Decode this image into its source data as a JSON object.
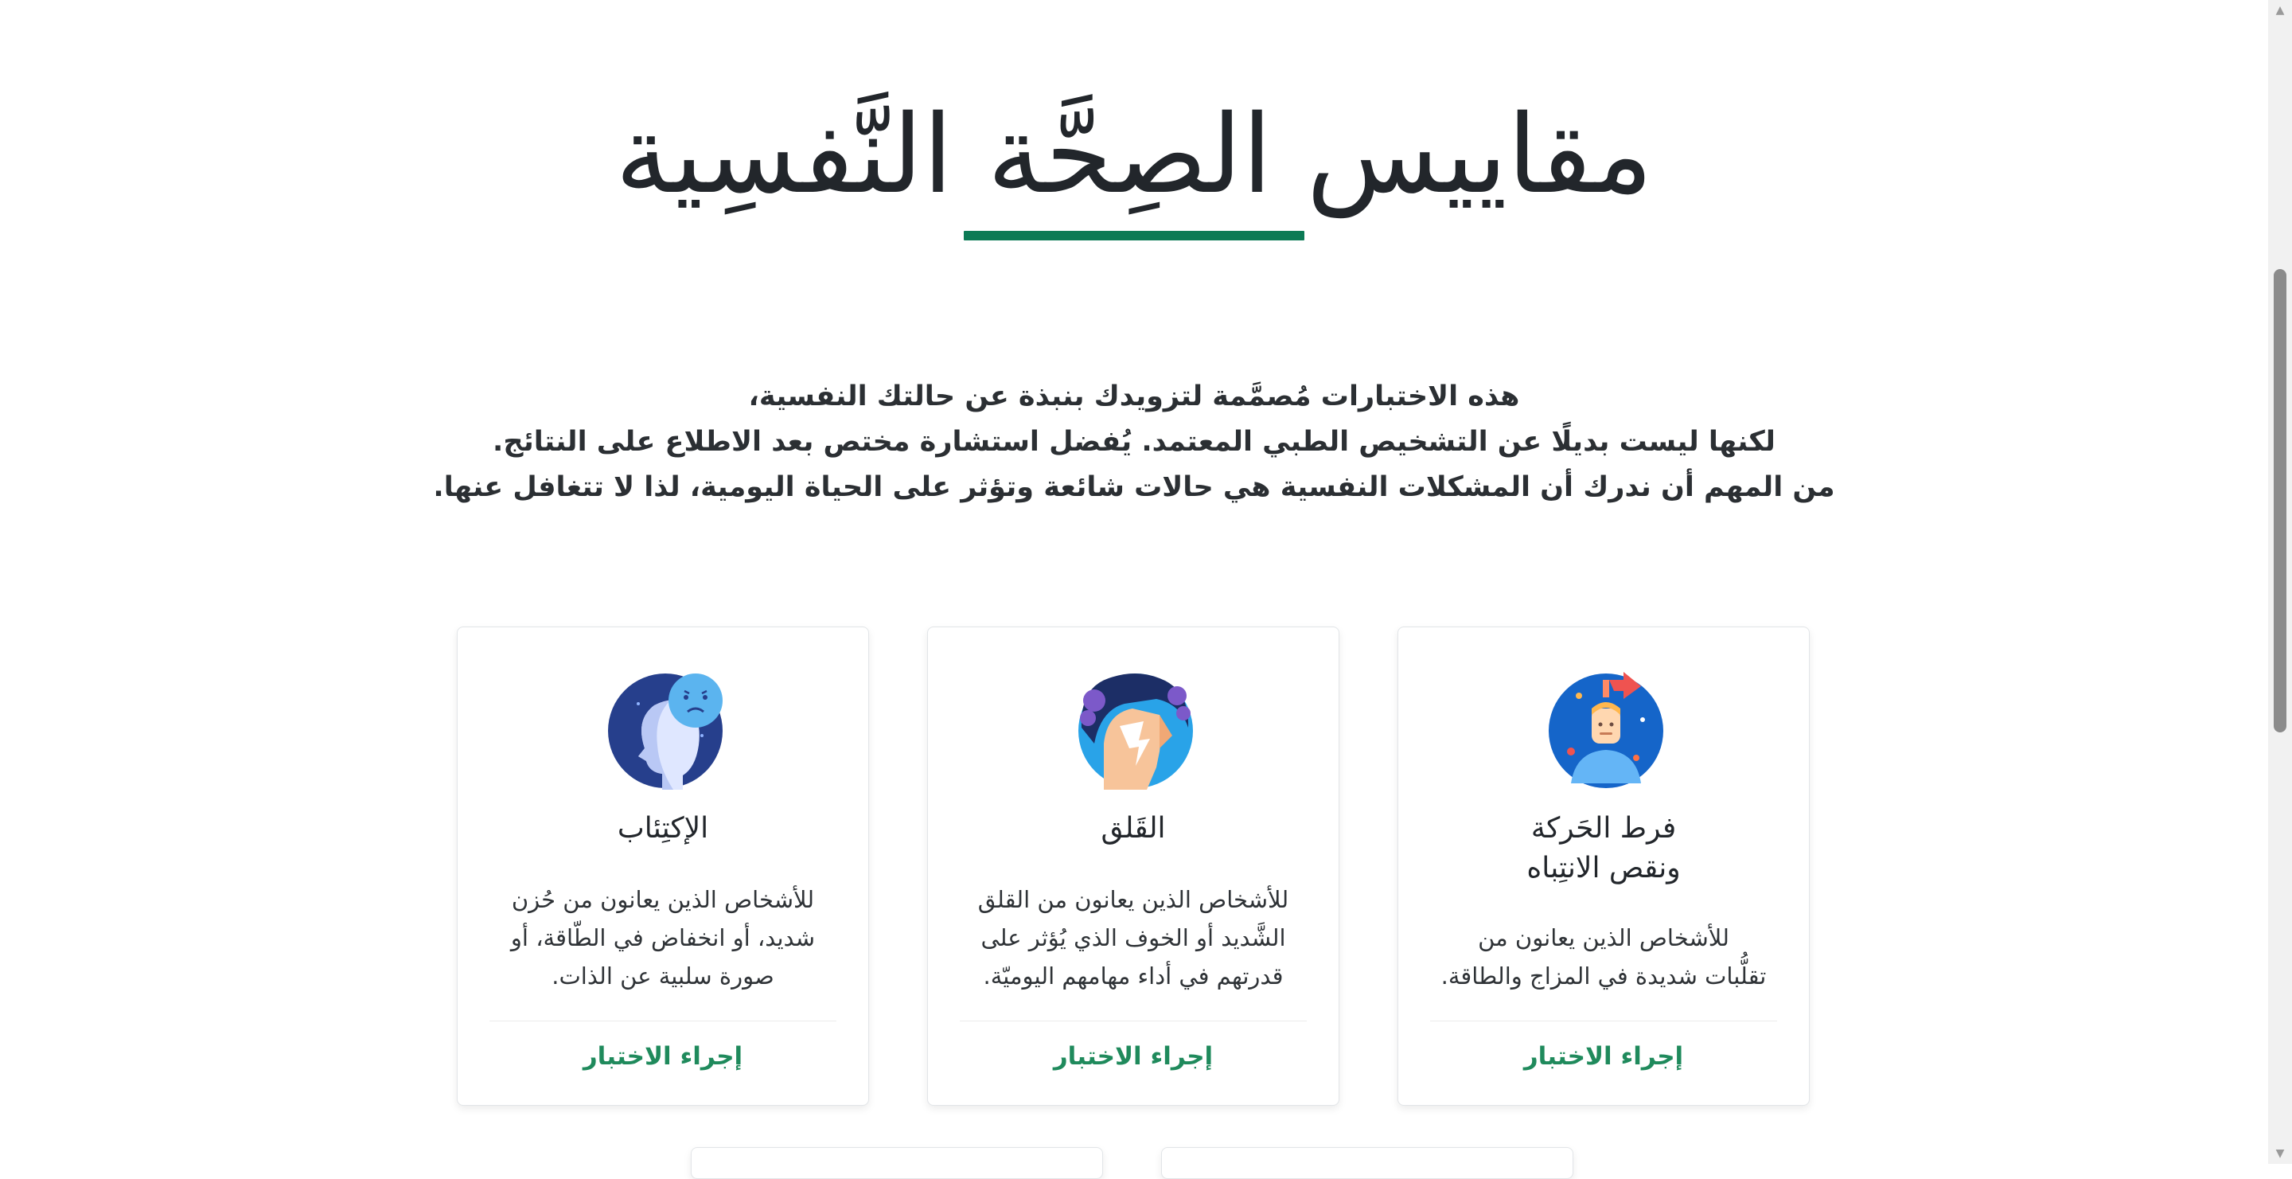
{
  "page": {
    "title": "مقاييس الصِحَّة النَّفسِية",
    "intro_lines": [
      "هذه الاختبارات مُصمَّمة لتزويدك بنبذة عن حالتك النفسية،",
      "لكنها ليست بديلًا عن التشخيص الطبي المعتمد. يُفضل استشارة مختص بعد الاطلاع على النتائج.",
      "من المهم أن ندرك أن المشكلات النفسية هي حالات شائعة وتؤثر على الحياة اليومية، لذا لا تتغافل عنها."
    ],
    "accent_color": "#0c7a55",
    "link_color": "#1f8a5c"
  },
  "cards": [
    {
      "icon": "adhd-icon",
      "title_line1": "فرط الحَركة",
      "title_line2": "ونقص الانتِباه",
      "desc_lines": [
        "للأشخاص الذين يعانون من",
        "تقلُّبات شديدة في المزاج والطاقة."
      ],
      "link": "إجراء الاختبار"
    },
    {
      "icon": "anxiety-icon",
      "title_line1": "القَلق",
      "desc_lines": [
        "للأشخاص الذين يعانون من القلق",
        "الشَّديد أو الخوف الذي يُؤثر على",
        "قدرتهم في أداء مهامهم اليوميّة."
      ],
      "link": "إجراء الاختبار"
    },
    {
      "icon": "depression-icon",
      "title_line1": "الإكتِئاب",
      "desc_lines": [
        "للأشخاص الذين يعانون من حُزن",
        "شديد، أو انخفاض في الطّاقة، أو",
        "صورة سلبية عن الذات."
      ],
      "link": "إجراء الاختبار"
    }
  ]
}
